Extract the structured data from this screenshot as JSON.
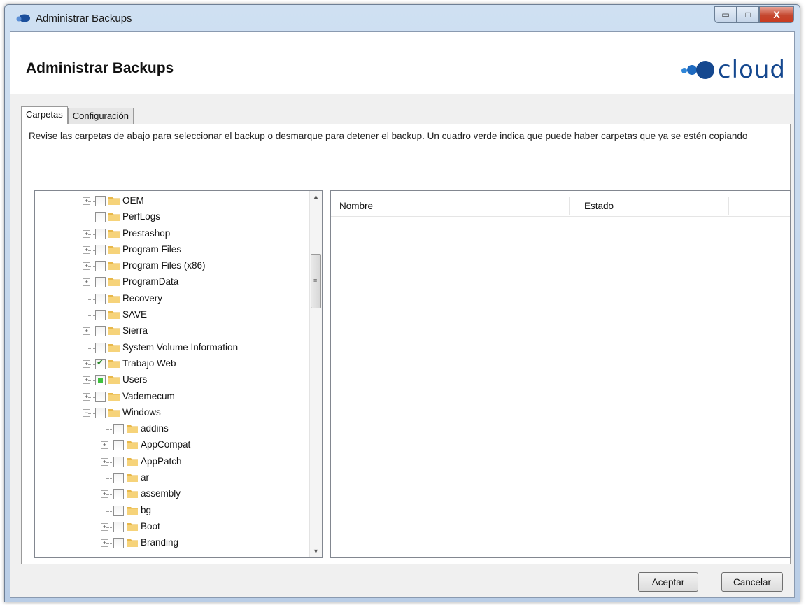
{
  "window": {
    "title": "Administrar Backups",
    "controls": {
      "minimize": "▭",
      "maximize": "□",
      "close": "X"
    }
  },
  "header": {
    "title": "Administrar Backups",
    "logo_text": "cloud"
  },
  "tabs": [
    {
      "label": "Carpetas",
      "active": true
    },
    {
      "label": "Configuración",
      "active": false
    }
  ],
  "description": "Revise las carpetas de abajo para seleccionar el backup o desmarque para detener el backup. Un cuadro verde indica que puede haber carpetas que ya se estén copiando",
  "tree": {
    "items": [
      {
        "label": "OEM",
        "level": 0,
        "expandable": true,
        "check": "none"
      },
      {
        "label": "PerfLogs",
        "level": 0,
        "expandable": false,
        "check": "none"
      },
      {
        "label": "Prestashop",
        "level": 0,
        "expandable": true,
        "check": "none"
      },
      {
        "label": "Program Files",
        "level": 0,
        "expandable": true,
        "check": "none"
      },
      {
        "label": "Program Files (x86)",
        "level": 0,
        "expandable": true,
        "check": "none"
      },
      {
        "label": "ProgramData",
        "level": 0,
        "expandable": true,
        "check": "none"
      },
      {
        "label": "Recovery",
        "level": 0,
        "expandable": false,
        "check": "none"
      },
      {
        "label": "SAVE",
        "level": 0,
        "expandable": false,
        "check": "none"
      },
      {
        "label": "Sierra",
        "level": 0,
        "expandable": true,
        "check": "none"
      },
      {
        "label": "System Volume Information",
        "level": 0,
        "expandable": false,
        "check": "none"
      },
      {
        "label": "Trabajo Web",
        "level": 0,
        "expandable": true,
        "check": "checked"
      },
      {
        "label": "Users",
        "level": 0,
        "expandable": true,
        "check": "partial"
      },
      {
        "label": "Vademecum",
        "level": 0,
        "expandable": true,
        "check": "none"
      },
      {
        "label": "Windows",
        "level": 0,
        "expandable": true,
        "expanded": true,
        "check": "none"
      },
      {
        "label": "addins",
        "level": 1,
        "expandable": false,
        "check": "none"
      },
      {
        "label": "AppCompat",
        "level": 1,
        "expandable": true,
        "check": "none"
      },
      {
        "label": "AppPatch",
        "level": 1,
        "expandable": true,
        "check": "none"
      },
      {
        "label": "ar",
        "level": 1,
        "expandable": false,
        "check": "none"
      },
      {
        "label": "assembly",
        "level": 1,
        "expandable": true,
        "check": "none"
      },
      {
        "label": "bg",
        "level": 1,
        "expandable": false,
        "check": "none"
      },
      {
        "label": "Boot",
        "level": 1,
        "expandable": true,
        "check": "none"
      },
      {
        "label": "Branding",
        "level": 1,
        "expandable": true,
        "check": "none"
      }
    ]
  },
  "list": {
    "columns": [
      "Nombre",
      "Estado"
    ]
  },
  "buttons": {
    "accept": "Aceptar",
    "cancel": "Cancelar"
  },
  "colors": {
    "logo_blue": "#15488f",
    "partial_green": "#3fc13f"
  }
}
